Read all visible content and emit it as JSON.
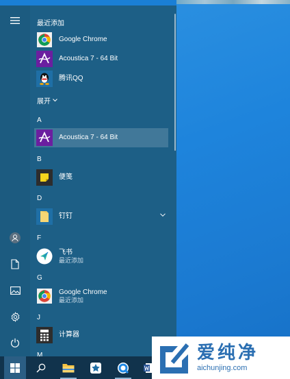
{
  "start_menu": {
    "recent_section": {
      "title": "最近添加"
    },
    "recent_apps": [
      {
        "name": "Google Chrome",
        "icon": "chrome-icon"
      },
      {
        "name": "Acoustica 7 - 64 Bit",
        "icon": "acoustica-icon"
      },
      {
        "name": "腾讯QQ",
        "icon": "qq-icon"
      }
    ],
    "expand_label": "展开",
    "groups": [
      {
        "letter": "A",
        "apps": [
          {
            "name": "Acoustica 7 - 64 Bit",
            "icon": "acoustica-icon",
            "selected": true
          }
        ]
      },
      {
        "letter": "B",
        "apps": [
          {
            "name": "便笺",
            "icon": "sticky-notes-icon"
          }
        ]
      },
      {
        "letter": "D",
        "apps": [
          {
            "name": "钉钉",
            "icon": "folder-icon",
            "expandable": true
          }
        ]
      },
      {
        "letter": "F",
        "apps": [
          {
            "name": "飞书",
            "subtitle": "最近添加",
            "icon": "feishu-icon"
          }
        ]
      },
      {
        "letter": "G",
        "apps": [
          {
            "name": "Google Chrome",
            "subtitle": "最近添加",
            "icon": "chrome-icon"
          }
        ]
      },
      {
        "letter": "J",
        "apps": [
          {
            "name": "计算器",
            "icon": "calculator-icon"
          }
        ]
      },
      {
        "letter": "M",
        "apps": []
      }
    ],
    "rail_icons": [
      "hamburger-icon",
      "user-avatar-icon",
      "documents-icon",
      "pictures-icon",
      "settings-icon",
      "power-icon"
    ]
  },
  "taskbar": {
    "items": [
      "windows-start-icon",
      "search-icon",
      "file-explorer-icon",
      "feishu-taskbar-icon",
      "browser-icon",
      "word-icon"
    ]
  },
  "watermark": {
    "title": "爱纯净",
    "url": "aichunjing.com"
  },
  "colors": {
    "menu_bg": "#1d5f86",
    "taskbar_bg": "#11334c",
    "desktop_bg": "#1a7fd6",
    "watermark_text": "#2b6fb2"
  }
}
